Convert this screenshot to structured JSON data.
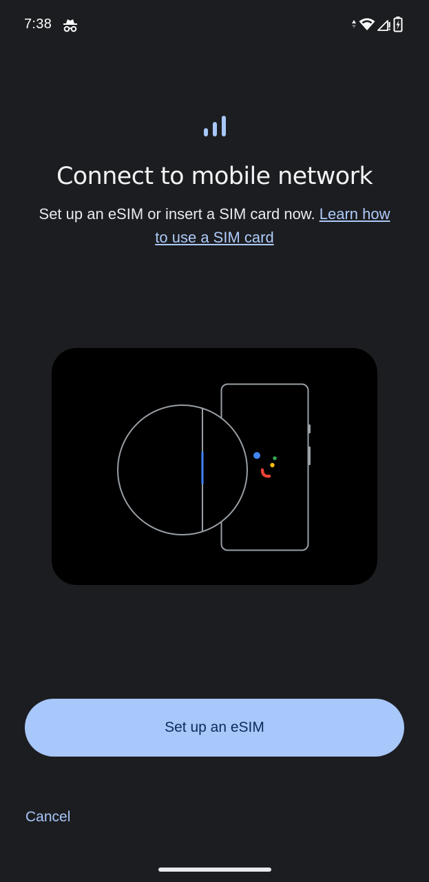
{
  "status_bar": {
    "time": "7:38",
    "icons": [
      "incognito-icon",
      "data-arrows-icon",
      "wifi-icon",
      "cellular-signal-icon",
      "battery-charging-icon"
    ]
  },
  "header": {
    "icon": "cellular-signal-icon",
    "title": "Connect to mobile network",
    "subtitle": "Set up an eSIM or insert a SIM card now.",
    "link_text": "Learn how to use a SIM card"
  },
  "illustration": {
    "description_icon": "sim-phone-illustration"
  },
  "actions": {
    "primary_label": "Set up an eSIM",
    "cancel_label": "Cancel"
  },
  "colors": {
    "background": "#1c1d20",
    "accent": "#a8c7fa",
    "link": "#aecbfa",
    "button_text": "#0b2a5c",
    "google_blue": "#4285f4",
    "google_red": "#ea4335",
    "google_yellow": "#fbbc04",
    "google_green": "#34a853"
  }
}
